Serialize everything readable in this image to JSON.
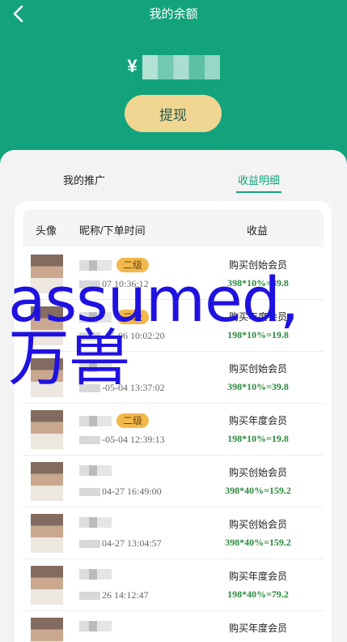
{
  "header": {
    "title": "我的余额",
    "balance_prefix": "¥",
    "withdraw_label": "提现",
    "accent_color": "#12a37c",
    "back_icon": "chevron-left-icon"
  },
  "tabs": [
    {
      "label": "我的推广",
      "active": false
    },
    {
      "label": "收益明细",
      "active": true
    }
  ],
  "table": {
    "columns": [
      "头像",
      "昵称/下单时间",
      "收益"
    ],
    "rows": [
      {
        "level": "二级",
        "time": "07 10:36:12",
        "product": "购买创始会员",
        "calc": "398*10%=39.8"
      },
      {
        "level": "二级",
        "time": "-05-06 10:02:20",
        "product": "购买年度会员",
        "calc": "198*10%=19.8"
      },
      {
        "level": "",
        "time": "-05-04 13:37:02",
        "product": "购买创始会员",
        "calc": "398*10%=39.8"
      },
      {
        "level": "二级",
        "time": "-05-04 12:39:13",
        "product": "购买年度会员",
        "calc": "198*10%=19.8"
      },
      {
        "level": "",
        "time": "04-27 16:49:00",
        "product": "购买创始会员",
        "calc": "398*40%=159.2"
      },
      {
        "level": "",
        "time": "04-27 13:04:57",
        "product": "购买创始会员",
        "calc": "398*40%=159.2"
      },
      {
        "level": "",
        "time": "26 14:12:47",
        "product": "购买年度会员",
        "calc": "198*40%=79.2"
      },
      {
        "level": "",
        "time": "",
        "product": "购买年度会员",
        "calc": ""
      }
    ]
  },
  "watermark": {
    "text": "assumed,万兽"
  }
}
